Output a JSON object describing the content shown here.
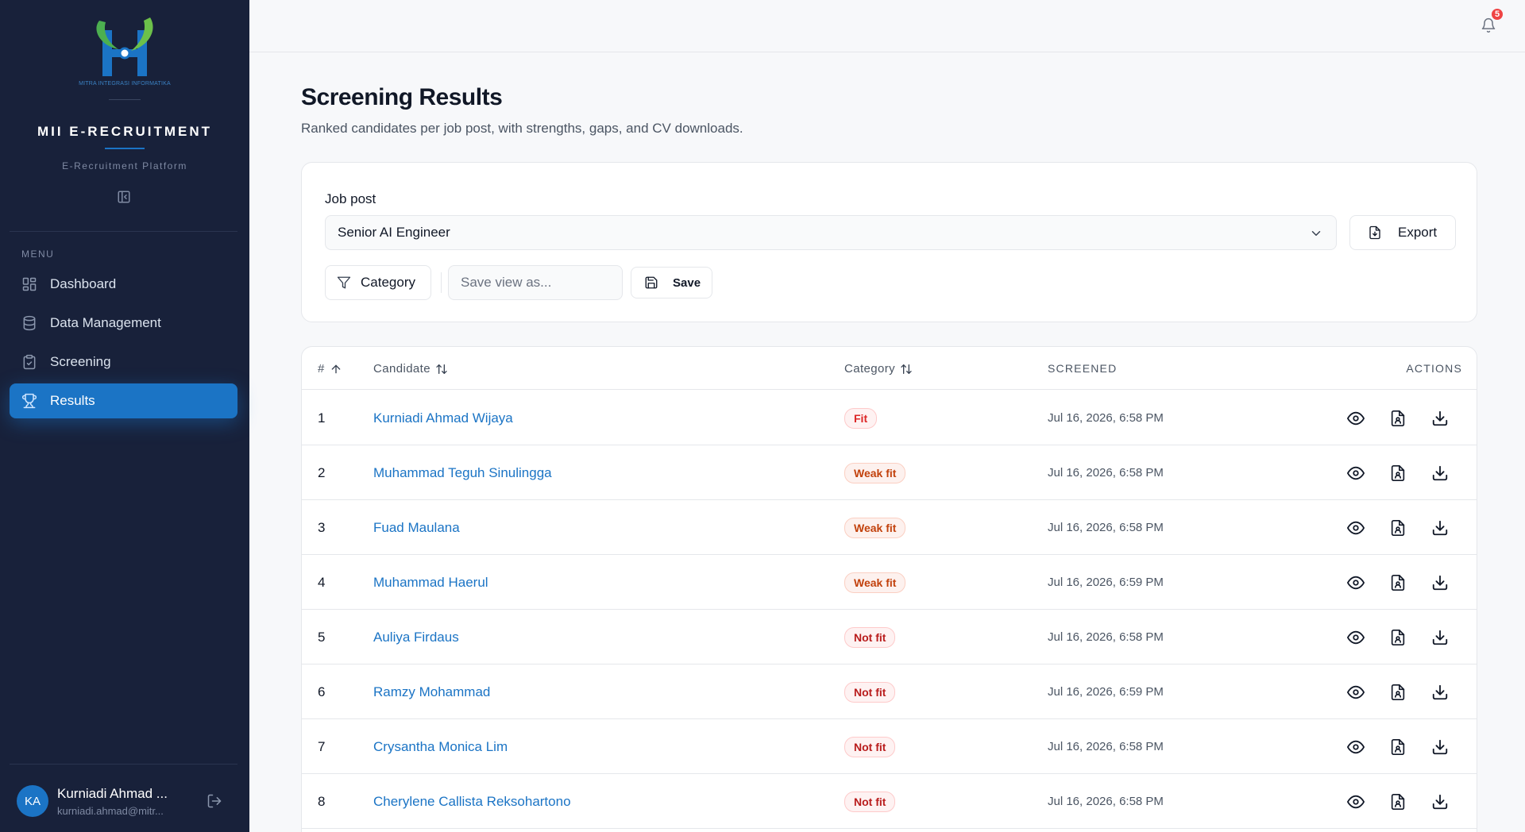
{
  "sidebar": {
    "logo_caption": "MITRA INTEGRASI INFORMATIKA",
    "brand": "MII E-RECRUITMENT",
    "subtitle": "E-Recruitment Platform",
    "menu_label": "MENU",
    "items": [
      {
        "label": "Dashboard",
        "icon": "dashboard-icon",
        "active": false
      },
      {
        "label": "Data Management",
        "icon": "database-icon",
        "active": false
      },
      {
        "label": "Screening",
        "icon": "clipboard-check-icon",
        "active": false
      },
      {
        "label": "Results",
        "icon": "trophy-icon",
        "active": true
      }
    ],
    "user": {
      "initials": "KA",
      "name": "Kurniadi Ahmad ...",
      "email": "kurniadi.ahmad@mitr..."
    }
  },
  "topbar": {
    "notification_count": "5"
  },
  "header": {
    "title": "Screening Results",
    "subtitle": "Ranked candidates per job post, with strengths, gaps, and CV downloads."
  },
  "filters": {
    "job_post_label": "Job post",
    "job_post_value": "Senior AI Engineer",
    "export_label": "Export",
    "category_label": "Category",
    "save_view_placeholder": "Save view as...",
    "save_label": "Save"
  },
  "table": {
    "columns": {
      "rank": "#",
      "candidate": "Candidate",
      "category": "Category",
      "screened": "Screened",
      "actions": "Actions"
    },
    "rows": [
      {
        "rank": "1",
        "name": "Kurniadi Ahmad Wijaya",
        "category": "Fit",
        "level": "fit",
        "screened": "Jul 16, 2026, 6:58 PM"
      },
      {
        "rank": "2",
        "name": "Muhammad Teguh Sinulingga",
        "category": "Weak fit",
        "level": "weak",
        "screened": "Jul 16, 2026, 6:58 PM"
      },
      {
        "rank": "3",
        "name": "Fuad Maulana",
        "category": "Weak fit",
        "level": "weak",
        "screened": "Jul 16, 2026, 6:58 PM"
      },
      {
        "rank": "4",
        "name": "Muhammad Haerul",
        "category": "Weak fit",
        "level": "weak",
        "screened": "Jul 16, 2026, 6:59 PM"
      },
      {
        "rank": "5",
        "name": "Auliya Firdaus",
        "category": "Not fit",
        "level": "notfit",
        "screened": "Jul 16, 2026, 6:58 PM"
      },
      {
        "rank": "6",
        "name": "Ramzy Mohammad",
        "category": "Not fit",
        "level": "notfit",
        "screened": "Jul 16, 2026, 6:59 PM"
      },
      {
        "rank": "7",
        "name": "Crysantha Monica Lim",
        "category": "Not fit",
        "level": "notfit",
        "screened": "Jul 16, 2026, 6:58 PM"
      },
      {
        "rank": "8",
        "name": "Cherylene Callista Reksohartono",
        "category": "Not fit",
        "level": "notfit",
        "screened": "Jul 16, 2026, 6:58 PM"
      }
    ]
  },
  "colors": {
    "accent": "#1b74c5",
    "sidebar_bg": "#18213a",
    "badge_red": "#dc2626"
  }
}
